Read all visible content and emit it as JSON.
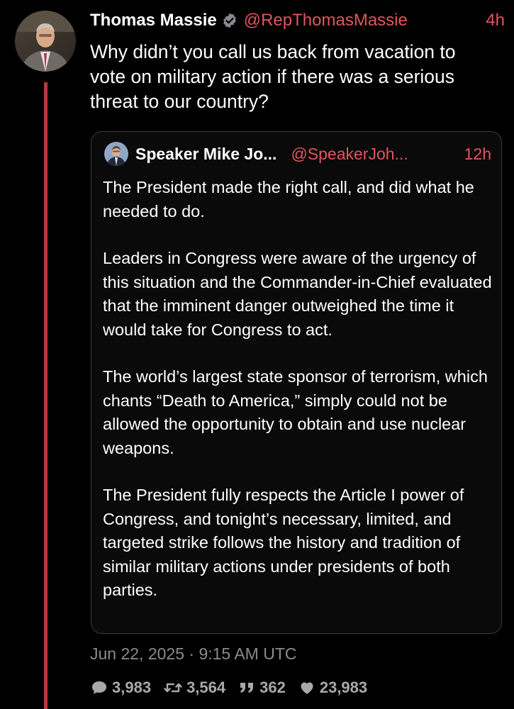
{
  "tweet": {
    "author_name": "Thomas Massie",
    "handle": "@RepThomasMassie",
    "time_ago": "4h",
    "text": "Why didn’t you call us back from vacation to vote on military action if there was a serious threat to our country?",
    "timestamp": "Jun 22, 2025 · 9:15 AM UTC"
  },
  "quote": {
    "author_name": "Speaker Mike Jo...",
    "handle": "@SpeakerJoh...",
    "time_ago": "12h",
    "paragraphs": [
      "The President made the right call, and did what he needed to do.",
      "Leaders in Congress were aware of the urgency of this situation and the Commander-in-Chief evaluated that the imminent danger outweighed the time it would take for Congress to act.",
      "The world’s largest state sponsor of terrorism, which chants “Death to America,” simply could not be allowed the opportunity to obtain and use nuclear weapons.",
      "The President fully respects the Article I power of Congress, and tonight’s necessary, limited, and targeted strike follows the history and tradition of similar military actions under presidents of both parties."
    ]
  },
  "stats": {
    "replies": "3,983",
    "retweets": "3,564",
    "quotes": "362",
    "likes": "23,983"
  },
  "icons": {
    "verified": "verified-badge-icon",
    "reply": "speech-bubble-icon",
    "retweet": "retweet-icon",
    "quote": "quote-marks-icon",
    "like": "heart-icon"
  },
  "colors": {
    "background": "#000000",
    "accent": "#e0565d",
    "thread_line": "#b53a3f",
    "muted": "#8b8b8f",
    "text": "#ffffff"
  }
}
